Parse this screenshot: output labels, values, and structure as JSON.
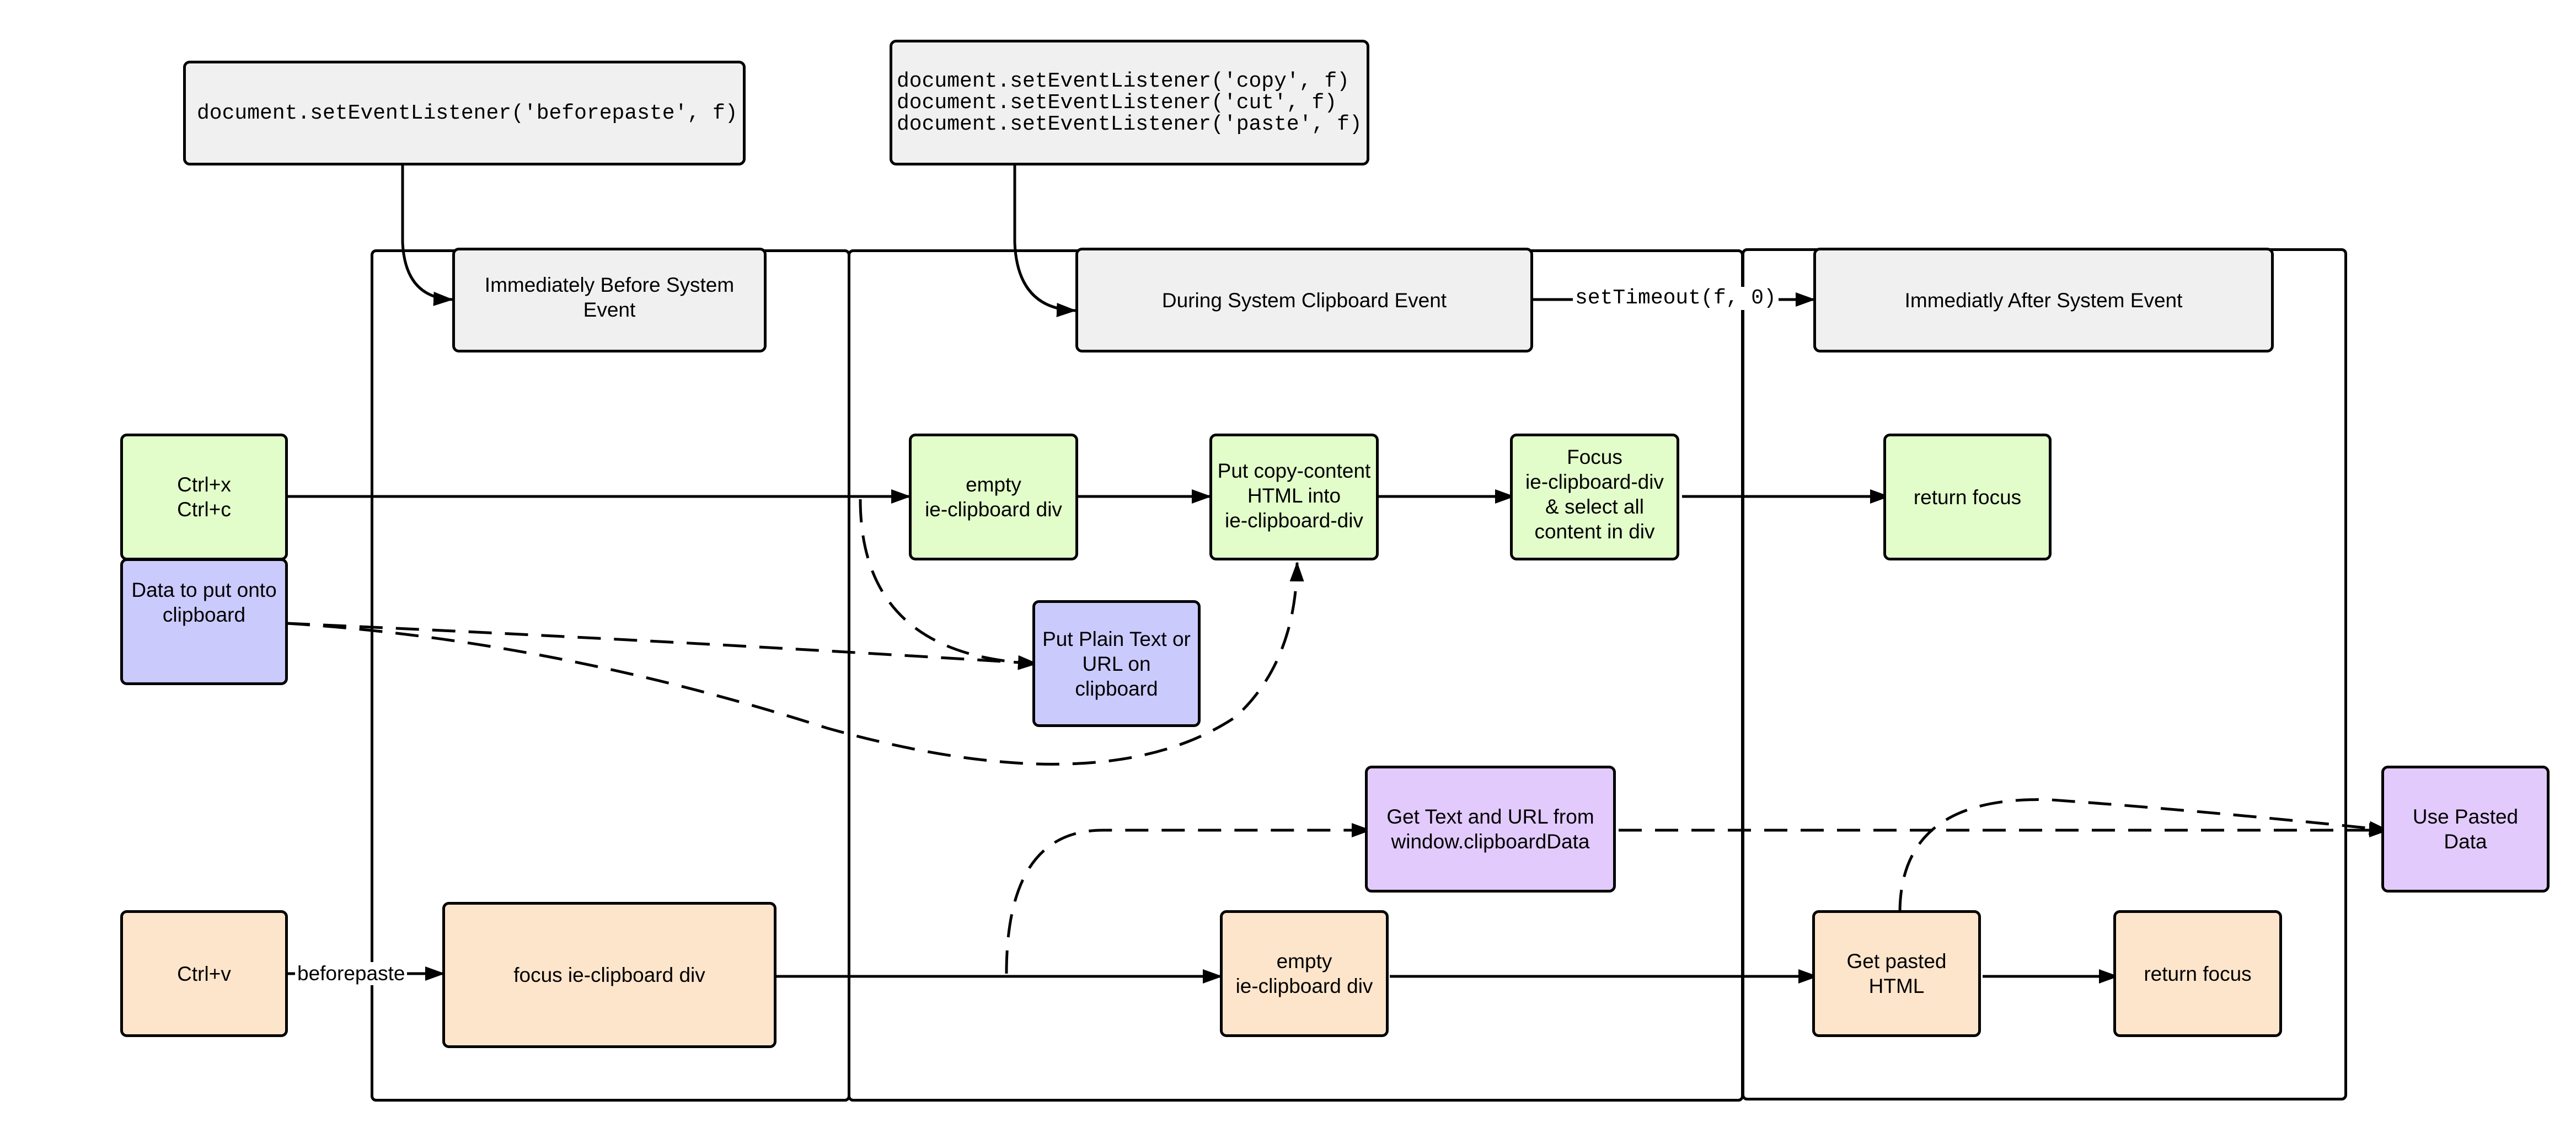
{
  "diagram": {
    "colors": {
      "header": "#f0f0f0",
      "copy_flow": "#e2fdca",
      "clipboard_data": "#cbcafd",
      "paste_data": "#e3cafd",
      "paste_flow": "#fde5cb",
      "stroke": "#000000"
    },
    "code_boxes": {
      "beforepaste": "document.setEventListener('beforepaste', f)",
      "copy_cut_paste": "document.setEventListener('copy', f)\ndocument.setEventListener('cut', f)\ndocument.setEventListener('paste', f)"
    },
    "phases": {
      "before": "Immediately Before System\nEvent",
      "during": "During System Clipboard Event",
      "after": "Immediatly After System Event"
    },
    "edge_labels": {
      "set_timeout": "setTimeout(f, 0)",
      "beforepaste": "beforepaste"
    },
    "copy_row": {
      "trigger": "Ctrl+x\nCtrl+c",
      "data_source": "Data to put onto\nclipboard",
      "empty_div": "empty\nie-clipboard div",
      "put_html": "Put copy-content\nHTML into\nie-clipboard-div",
      "focus_select": "Focus\nie-clipboard-div\n& select all\ncontent in div",
      "return_focus": "return focus",
      "put_plain_text": "Put Plain Text or\nURL on\nclipboard"
    },
    "paste_row": {
      "trigger": "Ctrl+v",
      "focus_div": "focus ie-clipboard div",
      "empty_div": "empty\nie-clipboard div",
      "get_text_url": "Get Text and URL from\nwindow.clipboardData",
      "get_pasted_html": "Get pasted\nHTML",
      "return_focus": "return focus",
      "use_pasted_data": "Use Pasted\nData"
    }
  }
}
